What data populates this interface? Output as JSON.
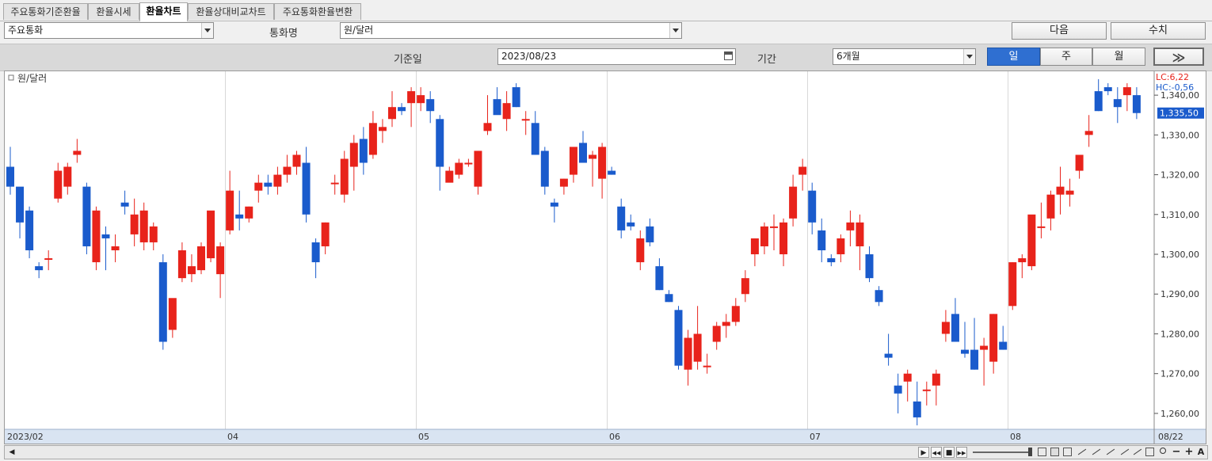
{
  "tabs": [
    {
      "label": "주요통화기준환율",
      "active": false
    },
    {
      "label": "환율시세",
      "active": false
    },
    {
      "label": "환율차트",
      "active": true
    },
    {
      "label": "환율상대비교차트",
      "active": false
    },
    {
      "label": "주요통화환율변환",
      "active": false
    }
  ],
  "toolbar": {
    "group_select": "주요통화",
    "currency_label": "통화명",
    "currency_select": "원/달러",
    "next_button": "다음",
    "value_button": "수치"
  },
  "filter": {
    "date_label": "기준일",
    "date_value": "2023/08/23",
    "period_label": "기간",
    "period_value": "6개월",
    "period_buttons": [
      {
        "label": "일",
        "active": true
      },
      {
        "label": "주",
        "active": false
      },
      {
        "label": "월",
        "active": false
      }
    ],
    "expand_glyph": "≫"
  },
  "chart_data": {
    "type": "candlestick",
    "title": "원/달러",
    "lc_label": "LC:6,22",
    "hc_label": "HC:-0,56",
    "current_label": "1,335,50",
    "current_value": 1335.5,
    "ylim": [
      1256,
      1346
    ],
    "yticks": [
      {
        "v": 1340,
        "label": "1,340,00"
      },
      {
        "v": 1330,
        "label": "1,330,00"
      },
      {
        "v": 1320,
        "label": "1,320,00"
      },
      {
        "v": 1310,
        "label": "1,310,00"
      },
      {
        "v": 1300,
        "label": "1,300,00"
      },
      {
        "v": 1290,
        "label": "1,290,00"
      },
      {
        "v": 1280,
        "label": "1,280,00"
      },
      {
        "v": 1270,
        "label": "1,270,00"
      },
      {
        "v": 1260,
        "label": "1,260,00"
      }
    ],
    "xticks": [
      {
        "i": 0,
        "label": "2023/02"
      },
      {
        "i": 23,
        "label": "04"
      },
      {
        "i": 43,
        "label": "05"
      },
      {
        "i": 63,
        "label": "06"
      },
      {
        "i": 84,
        "label": "07"
      },
      {
        "i": 105,
        "label": "08"
      },
      {
        "i": 120,
        "label": "08/22"
      }
    ],
    "colors": {
      "up": "#e8231b",
      "down": "#1a5bcc",
      "grid": "#d8d8d8"
    },
    "candles": [
      [
        1322,
        1327,
        1315,
        1317
      ],
      [
        1317,
        1316,
        1304,
        1308
      ],
      [
        1311,
        1312,
        1299,
        1301
      ],
      [
        1297,
        1298,
        1294,
        1296
      ],
      [
        1299,
        1301,
        1296,
        1299
      ],
      [
        1314,
        1323,
        1313,
        1321
      ],
      [
        1317,
        1323,
        1315,
        1322
      ],
      [
        1325,
        1329,
        1323,
        1326
      ],
      [
        1317,
        1318,
        1300,
        1302
      ],
      [
        1298,
        1312,
        1296,
        1311
      ],
      [
        1305,
        1307,
        1296,
        1304
      ],
      [
        1301,
        1305,
        1298,
        1302
      ],
      [
        1313,
        1316,
        1310,
        1312
      ],
      [
        1305,
        1314,
        1302,
        1310
      ],
      [
        1303,
        1313,
        1301,
        1311
      ],
      [
        1303,
        1308,
        1301,
        1307
      ],
      [
        1298,
        1300,
        1276,
        1278
      ],
      [
        1281,
        1285,
        1279,
        1289
      ],
      [
        1294,
        1303,
        1293,
        1301
      ],
      [
        1295,
        1300,
        1293,
        1297
      ],
      [
        1296,
        1303,
        1295,
        1302
      ],
      [
        1299,
        1307,
        1298,
        1311
      ],
      [
        1295,
        1303,
        1289,
        1302
      ],
      [
        1306,
        1321,
        1305,
        1316
      ],
      [
        1310,
        1316,
        1306,
        1309
      ],
      [
        1309,
        1312,
        1308,
        1312
      ],
      [
        1316,
        1320,
        1313,
        1318
      ],
      [
        1318,
        1320,
        1315,
        1317
      ],
      [
        1317,
        1322,
        1315,
        1320
      ],
      [
        1320,
        1325,
        1318,
        1322
      ],
      [
        1322,
        1326,
        1320,
        1325
      ],
      [
        1323,
        1327,
        1308,
        1310
      ],
      [
        1303,
        1304,
        1294,
        1298
      ],
      [
        1302,
        1308,
        1300,
        1308
      ],
      [
        1318,
        1320,
        1315,
        1318
      ],
      [
        1315,
        1326,
        1313,
        1324
      ],
      [
        1322,
        1330,
        1316,
        1328
      ],
      [
        1329,
        1332,
        1320,
        1323
      ],
      [
        1325,
        1336,
        1324,
        1333
      ],
      [
        1331,
        1334,
        1328,
        1332
      ],
      [
        1334,
        1341,
        1332,
        1337
      ],
      [
        1337,
        1338,
        1335,
        1336
      ],
      [
        1338,
        1342,
        1332,
        1341
      ],
      [
        1338,
        1342,
        1336,
        1340
      ],
      [
        1339,
        1341,
        1333,
        1336
      ],
      [
        1334,
        1335,
        1316,
        1322
      ],
      [
        1318,
        1322,
        1319,
        1321
      ],
      [
        1320,
        1324,
        1319,
        1323
      ],
      [
        1323,
        1324,
        1322,
        1323
      ],
      [
        1317,
        1326,
        1315,
        1326
      ],
      [
        1331,
        1340,
        1330,
        1333
      ],
      [
        1339,
        1342,
        1336,
        1335
      ],
      [
        1334,
        1341,
        1331,
        1338
      ],
      [
        1342,
        1343,
        1337,
        1337
      ],
      [
        1334,
        1336,
        1330,
        1334
      ],
      [
        1333,
        1336,
        1325,
        1325
      ],
      [
        1326,
        1327,
        1315,
        1317
      ],
      [
        1313,
        1314,
        1308,
        1312
      ],
      [
        1317,
        1319,
        1315,
        1319
      ],
      [
        1320,
        1324,
        1318,
        1327
      ],
      [
        1328,
        1331,
        1323,
        1323
      ],
      [
        1324,
        1326,
        1317,
        1325
      ],
      [
        1319,
        1328,
        1314,
        1327
      ],
      [
        1321,
        1322,
        1320,
        1320
      ],
      [
        1312,
        1314,
        1304,
        1306
      ],
      [
        1308,
        1310,
        1306,
        1307
      ],
      [
        1298,
        1306,
        1296,
        1304
      ],
      [
        1307,
        1309,
        1302,
        1303
      ],
      [
        1297,
        1299,
        1291,
        1291
      ],
      [
        1290,
        1291,
        1288,
        1288
      ],
      [
        1286,
        1287,
        1271,
        1272
      ],
      [
        1271,
        1281,
        1267,
        1279
      ],
      [
        1273,
        1287,
        1271,
        1280
      ],
      [
        1272,
        1275,
        1270,
        1272
      ],
      [
        1278,
        1283,
        1276,
        1282
      ],
      [
        1282,
        1285,
        1279,
        1283
      ],
      [
        1283,
        1289,
        1282,
        1287
      ],
      [
        1290,
        1296,
        1288,
        1294
      ],
      [
        1300,
        1304,
        1297,
        1304
      ],
      [
        1302,
        1308,
        1300,
        1307
      ],
      [
        1307,
        1310,
        1301,
        1307
      ],
      [
        1300,
        1309,
        1297,
        1308
      ],
      [
        1309,
        1320,
        1307,
        1317
      ],
      [
        1320,
        1324,
        1316,
        1322
      ],
      [
        1316,
        1318,
        1305,
        1308
      ],
      [
        1306,
        1309,
        1298,
        1301
      ],
      [
        1299,
        1300,
        1297,
        1298
      ],
      [
        1300,
        1305,
        1298,
        1304
      ],
      [
        1306,
        1311,
        1302,
        1308
      ],
      [
        1302,
        1310,
        1296,
        1308
      ],
      [
        1300,
        1302,
        1293,
        1294
      ],
      [
        1291,
        1292,
        1287,
        1288
      ],
      [
        1275,
        1280,
        1272,
        1274
      ],
      [
        1267,
        1270,
        1260,
        1265
      ],
      [
        1268,
        1271,
        1263,
        1270
      ],
      [
        1263,
        1268,
        1257,
        1259
      ],
      [
        1266,
        1268,
        1262,
        1266
      ],
      [
        1267,
        1271,
        1262,
        1270
      ],
      [
        1280,
        1286,
        1278,
        1283
      ],
      [
        1285,
        1289,
        1282,
        1278
      ],
      [
        1276,
        1283,
        1274,
        1275
      ],
      [
        1276,
        1284,
        1271,
        1271
      ],
      [
        1276,
        1279,
        1267,
        1277
      ],
      [
        1273,
        1285,
        1270,
        1285
      ],
      [
        1278,
        1282,
        1276,
        1276
      ],
      [
        1287,
        1298,
        1286,
        1298
      ],
      [
        1298,
        1300,
        1294,
        1299
      ],
      [
        1297,
        1306,
        1296,
        1310
      ],
      [
        1307,
        1313,
        1304,
        1307
      ],
      [
        1309,
        1316,
        1306,
        1315
      ],
      [
        1315,
        1322,
        1310,
        1317
      ],
      [
        1315,
        1319,
        1312,
        1316
      ],
      [
        1321,
        1324,
        1319,
        1325
      ],
      [
        1330,
        1335,
        1327,
        1331
      ],
      [
        1341,
        1344,
        1336,
        1336
      ],
      [
        1342,
        1343,
        1340,
        1341
      ],
      [
        1339,
        1342,
        1333,
        1337
      ],
      [
        1340,
        1343,
        1336,
        1342
      ],
      [
        1340,
        1342,
        1334,
        1335.5
      ]
    ]
  },
  "scrollbar": {
    "left_arrow": "◀",
    "right_arrow": "▶",
    "ctrl_play": "▶",
    "ctrl_rewind": "◀◀",
    "ctrl_stop": "■",
    "ctrl_forward": "▶▶",
    "zoom_in": "+",
    "zoom_out": "−",
    "auto": "A"
  }
}
